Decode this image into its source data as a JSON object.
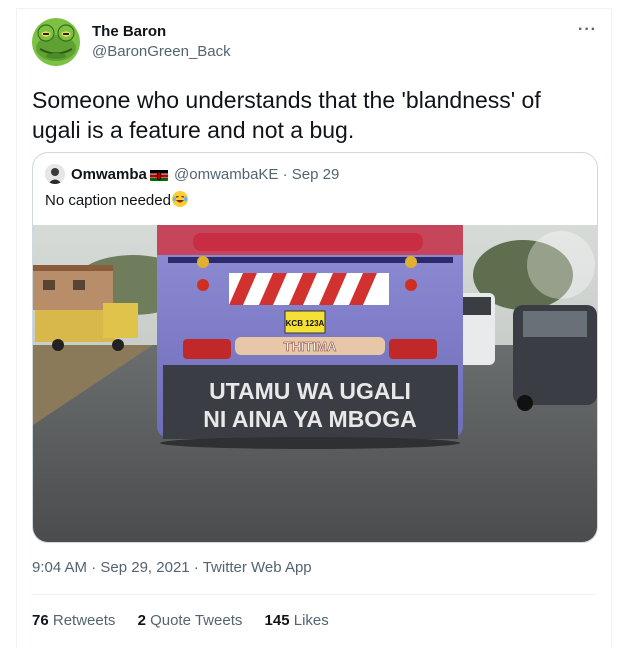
{
  "tweet": {
    "author_name": "The Baron",
    "author_handle": "@BaronGreen_Back",
    "more_label": "···",
    "text": "Someone who understands that the 'blandness' of ugali is a feature and not a bug.",
    "time": "9:04 AM",
    "sep1": " · ",
    "date": "Sep 29, 2021",
    "sep2": " · ",
    "source": "Twitter Web App"
  },
  "quoted": {
    "author_name": "Omwamba",
    "author_handle": "@omwambaKE",
    "sep": " · ",
    "date": "Sep 29",
    "text": "No caption needed",
    "image_text_line1": "UTAMU WA UGALI",
    "image_text_line2": "NI AINA YA MBOGA",
    "image_bus_name": "THITIMA",
    "image_plate": "KCB 123A"
  },
  "stats": {
    "retweets_count": "76",
    "retweets_label": "Retweets",
    "quotes_count": "2",
    "quotes_label": "Quote Tweets",
    "likes_count": "145",
    "likes_label": "Likes"
  },
  "colors": {
    "text_primary": "#0f1419",
    "text_secondary": "#536471",
    "border": "#cfd9de",
    "divider": "#eff3f4"
  },
  "icons": {
    "author_avatar": "frog-avatar-icon",
    "quoted_avatar": "person-avatar-icon",
    "flag": "kenya-flag-icon",
    "emoji": "laughing-crying-emoji-icon",
    "more": "more-dots-icon"
  }
}
